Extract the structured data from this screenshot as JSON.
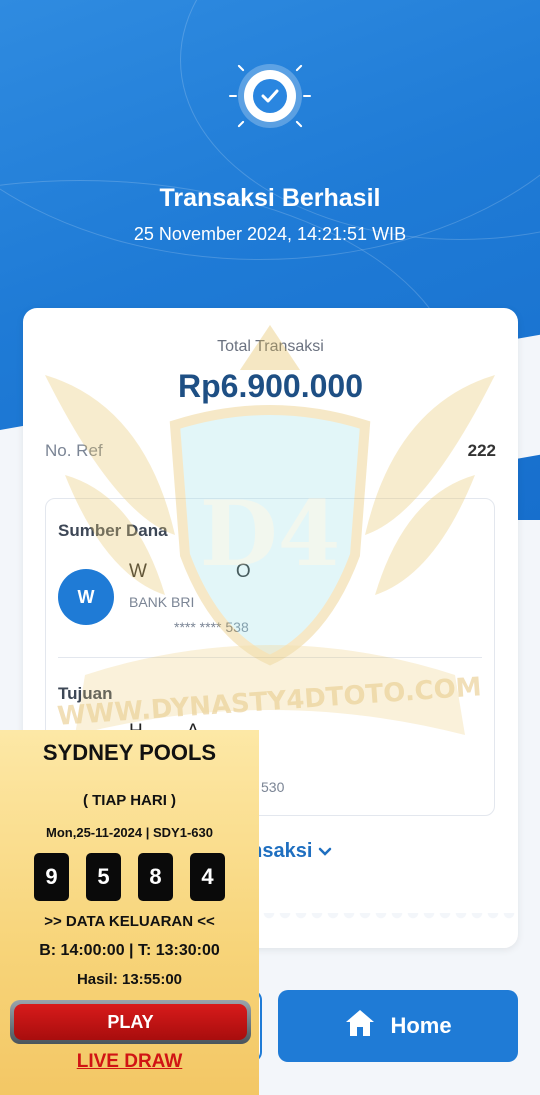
{
  "header": {
    "title": "Transaksi Berhasil",
    "datetime": "25 November 2024, 14:21:51 WIB"
  },
  "summary": {
    "total_label": "Total Transaksi",
    "total_amount": "Rp6.900.000",
    "ref_label": "No. Ref",
    "ref_value": "222"
  },
  "source": {
    "label": "Sumber Dana",
    "avatar_initial": "W",
    "name": "W              O",
    "bank": "BANK BRI",
    "account": "**** **** 538"
  },
  "destination": {
    "label": "Tujuan",
    "name": "H       A",
    "account": "530"
  },
  "detail_link_label": "l Transaksi",
  "buttons": {
    "home_label": "Home"
  },
  "promo": {
    "title": "SYDNEY POOLS",
    "subtitle": "( TIAP HARI )",
    "date_line": "Mon,25-11-2024 | SDY1-630",
    "digits": [
      "9",
      "5",
      "8",
      "4"
    ],
    "data_label": ">> DATA KELUARAN <<",
    "time_line": "B: 14:00:00 | T: 13:30:00",
    "hasil_line": "Hasil: 13:55:00",
    "play_label": "PLAY",
    "live_draw_label": "LIVE DRAW"
  },
  "watermark": {
    "text": "WWW.DYNASTY4DTOTO.COM",
    "logo": "D4"
  },
  "colors": {
    "primary": "#1f7bd6",
    "amount": "#1e4f84",
    "promo_bg": "#f7d479",
    "play": "#c41212"
  }
}
